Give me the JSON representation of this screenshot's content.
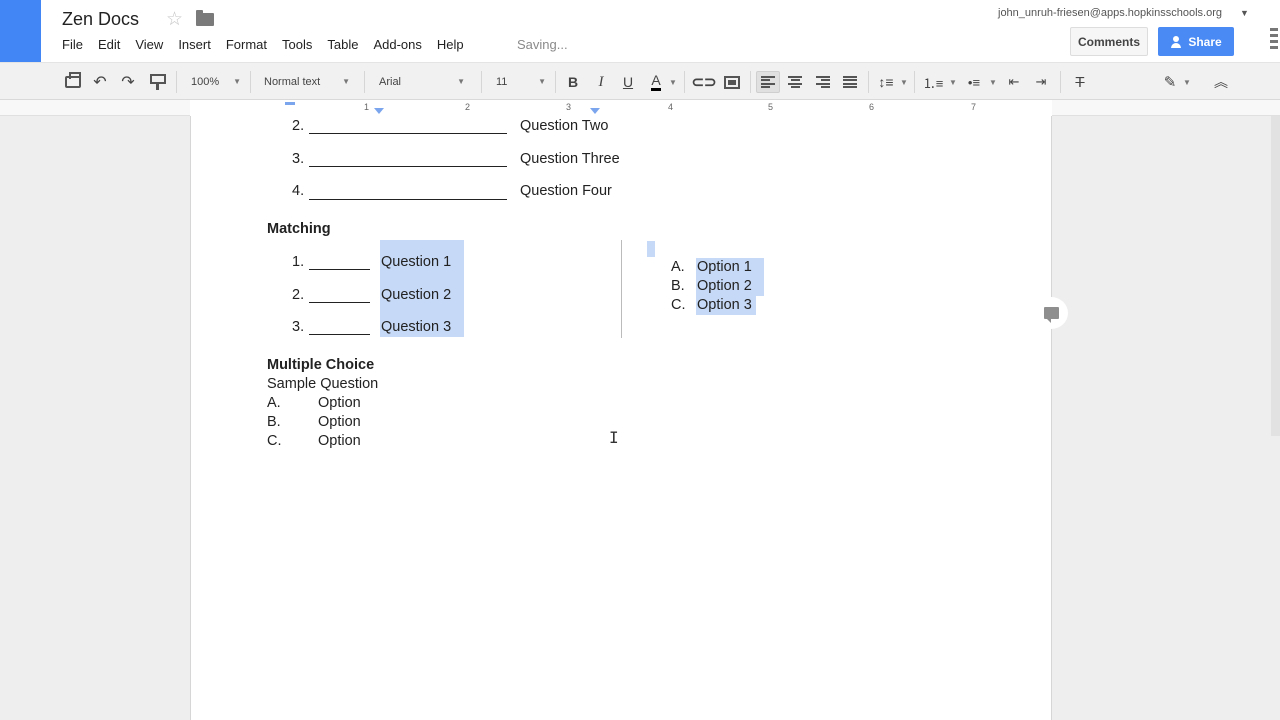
{
  "app": {
    "title": "Zen Docs",
    "status": "Saving...",
    "account": "john_unruh-friesen@apps.hopkinsschools.org"
  },
  "menu": [
    "File",
    "Edit",
    "View",
    "Insert",
    "Format",
    "Tools",
    "Table",
    "Add-ons",
    "Help"
  ],
  "buttons": {
    "comments": "Comments",
    "share": "Share"
  },
  "toolbar": {
    "zoom": "100%",
    "style": "Normal text",
    "font": "Arial",
    "size": "11",
    "bold": "B",
    "italic": "I",
    "underline": "U",
    "text_color": "A",
    "clear_format": "T"
  },
  "ruler": {
    "numbers": [
      "1",
      "2",
      "3",
      "4",
      "5",
      "6",
      "7"
    ]
  },
  "document": {
    "fill_in": [
      {
        "num": "2.",
        "text": "Question Two"
      },
      {
        "num": "3.",
        "text": "Question Three"
      },
      {
        "num": "4.",
        "text": "Question Four"
      }
    ],
    "matching_heading": "Matching",
    "matching_left": [
      {
        "num": "1.",
        "text": "Question 1"
      },
      {
        "num": "2.",
        "text": "Question 2"
      },
      {
        "num": "3.",
        "text": "Question 3"
      }
    ],
    "matching_right": [
      {
        "letter": "A.",
        "text": "Option 1"
      },
      {
        "letter": "B.",
        "text": "Option 2"
      },
      {
        "letter": "C.",
        "text": "Option 3"
      }
    ],
    "mc_heading": "Multiple Choice",
    "mc_question": "Sample Question",
    "mc_options": [
      {
        "letter": "A.",
        "text": "Option"
      },
      {
        "letter": "B.",
        "text": "Option"
      },
      {
        "letter": "C.",
        "text": "Option"
      }
    ]
  },
  "colors": {
    "accent": "#4285f4",
    "highlight": "#c6d9f6",
    "share": "#4a8af4"
  }
}
